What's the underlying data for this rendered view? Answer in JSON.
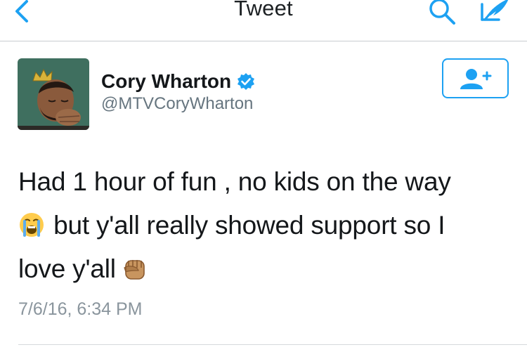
{
  "nav": {
    "title": "Tweet",
    "back_icon": "chevron-left-icon",
    "search_icon": "search-icon",
    "compose_icon": "compose-quill-icon"
  },
  "author": {
    "display_name": "Cory Wharton",
    "screen_name": "@MTVCoryWharton",
    "verified": true,
    "avatar_icon": "avatar-image"
  },
  "follow_button": {
    "icon": "add-person-icon"
  },
  "tweet": {
    "line1": "Had 1 hour of fun , no kids on the way",
    "line2_text": "but y'all really showed support so I",
    "line3_text": "love y'all",
    "emoji_crying": "loudly-crying-face-emoji",
    "emoji_fist": "raised-fist-emoji",
    "timestamp": "7/6/16, 6:34 PM"
  },
  "colors": {
    "accent": "#1da1f2",
    "text": "#14171a",
    "secondary": "#66757f",
    "divider": "#c8ccd0"
  }
}
